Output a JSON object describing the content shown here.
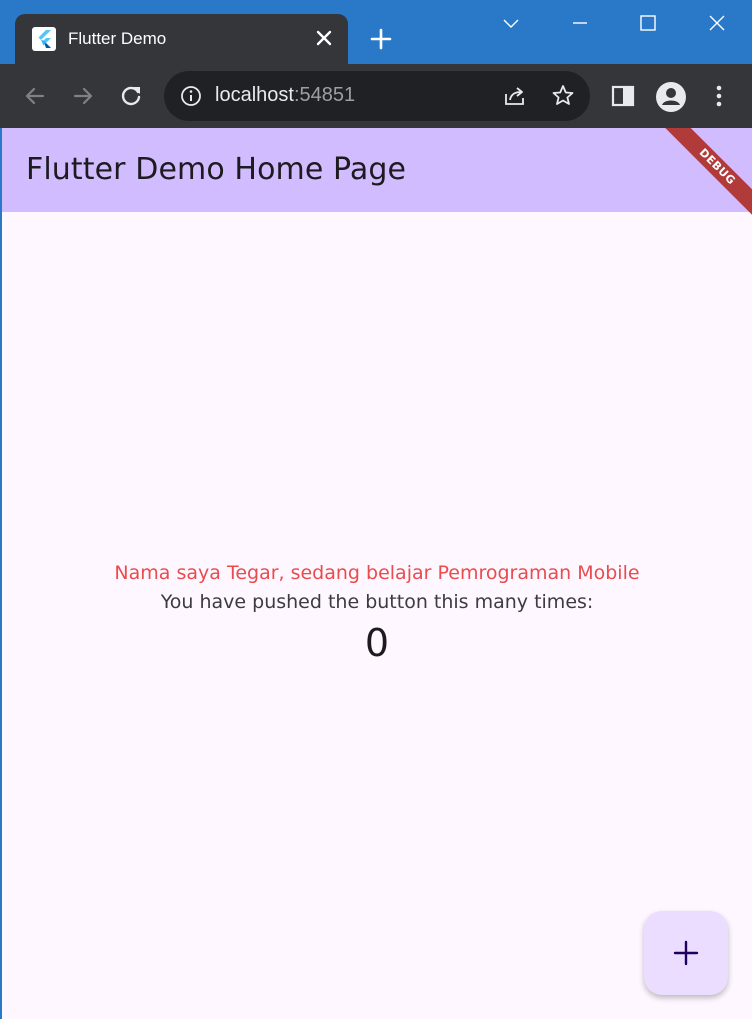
{
  "browser": {
    "tab": {
      "title": "Flutter Demo",
      "favicon": "flutter-logo-icon"
    },
    "new_tab_icon": "plus-icon",
    "window_controls": [
      "chevron-down-icon",
      "minimize-icon",
      "maximize-icon",
      "close-icon"
    ],
    "address_bar": {
      "host": "localhost",
      "port": ":54851",
      "info_icon": "info-icon"
    },
    "toolbar_icons": [
      "back-icon",
      "forward-icon",
      "reload-icon",
      "share-icon",
      "star-icon",
      "side-panel-icon",
      "profile-icon",
      "menu-icon"
    ]
  },
  "app": {
    "appbar_title": "Flutter Demo Home Page",
    "debug_banner": "DEBUG",
    "intro_text": "Nama saya Tegar, sedang belajar Pemrograman Mobile",
    "counter_label": "You have pushed the button this many times:",
    "counter_value": "0",
    "fab_icon": "add-icon",
    "colors": {
      "appbar": "#d1bcff",
      "background": "#fef7ff",
      "intro_text": "#e84c4c",
      "fab": "#eaddff",
      "browser_frame": "#2a79c9"
    }
  }
}
